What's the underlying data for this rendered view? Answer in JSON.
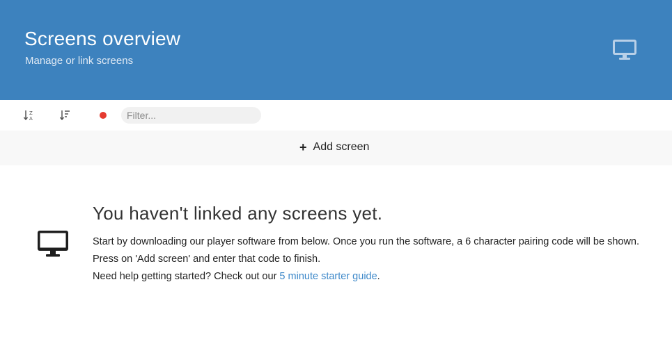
{
  "header": {
    "title": "Screens overview",
    "subtitle": "Manage or link screens",
    "icon": "monitor-icon",
    "background_color": "#3d82be"
  },
  "toolbar": {
    "sort_alpha_icon": "sort-alpha-icon",
    "sort_order_icon": "sort-order-icon",
    "status_color": "#e53b30",
    "filter": {
      "placeholder": "Filter...",
      "value": ""
    }
  },
  "add_screen": {
    "icon": "plus",
    "label": "Add screen"
  },
  "empty_state": {
    "icon": "monitor-icon",
    "title": "You haven't linked any screens yet.",
    "paragraph": "Start by downloading our player software from below. Once you run the software, a 6 character pairing code will be shown. Press on 'Add screen' and enter that code to finish.",
    "help_prefix": "Need help getting started? Check out our ",
    "help_link": "5 minute starter guide",
    "help_suffix": ".",
    "link_color": "#3d88c9"
  }
}
